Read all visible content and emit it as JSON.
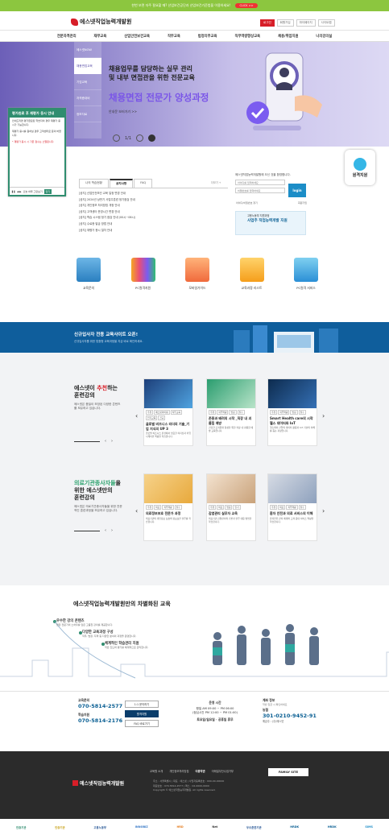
{
  "topbar": {
    "text": "한번 보면 자주 필요할 때? 산업보건공단과 산업보건기준법을 이용하세요!",
    "button": "CLICK >>"
  },
  "header": {
    "logo": "에스넷직업능력개발원",
    "util": [
      "로그인",
      "회원가입",
      "마이페이지",
      "사이트맵"
    ]
  },
  "gnb": [
    "전문자격관리",
    "재무교육",
    "산업안전보건교육",
    "직무교육",
    "법정의무교육",
    "직무역량향상교육",
    "채용/취업지원",
    "나의강의실"
  ],
  "hero": {
    "side": [
      "에스넷NOW",
      "채용면접교육",
      "기업교육",
      "자격증대비",
      "정보자료"
    ],
    "line1": "채용업무를 담당하는 실무 관리",
    "line2": "및 내부 면접관을 위한 전문교육",
    "title": "채용면접 전문가 양성과정",
    "cta": "안내문 보러가기 >>",
    "page": "1/1"
  },
  "popup": {
    "title": "평가완료 후 재평가 응시 안내",
    "body1": "안내드리면 평가완료된 학습자의 경우 재평가 응시가 가능합니다.",
    "body2": "재평가 응시를 원하실 경우 고객센터로 문의 바랍니다.",
    "note": "* 재평가 응시 시 기존 점수는 소멸됩니다.",
    "today": "오늘 하루 그만보기",
    "close": "닫기"
  },
  "recruit": "원격지원",
  "board": {
    "tabs": [
      "나의 학습현황",
      "공지사항",
      "FAQ"
    ],
    "more": "더보기 +",
    "items": [
      "[공지] 산업안전보건 교육 일정 변경 안내",
      "[공지] 2024년 상반기 사업주훈련 정기점검 안내",
      "[공지] 개인정보 처리방침 개정 안내",
      "[공지] 고객센터 운영시간 변경 안내",
      "[공지] 학습 시스템 정기 점검 안내 (00시~06시)",
      "[공지] 수료증 발급 방법 안내",
      "[공지] 재평가 응시 절차 안내"
    ]
  },
  "login": {
    "title": "에스넷직업능력개발원에 오신 것을 환영합니다.",
    "id_ph": "아이디를 입력하세요",
    "pw_ph": "비밀번호를 입력하세요",
    "button": "login",
    "links": [
      "아이디/비밀번호 찾기",
      "회원가입"
    ]
  },
  "banner2": {
    "line1": "고용노동부 지원과정",
    "line2": "사업주 직업능력개발 지원"
  },
  "quick": [
    "교육문의",
    "PC원격지원",
    "모바일가이드",
    "교육과정 리스트",
    "PC원격 서비스"
  ],
  "banner3": {
    "title": "신규입사자 전용 교육사이트 오픈!",
    "sub": "신규입사자를 위한 맞춤형 교육과정을 지금 바로 확인하세요."
  },
  "rec": {
    "t1": "에스넷이 ",
    "t1b": "추천",
    "t1c": "하는",
    "t2": "훈련강의",
    "sub": "에스넷은 품질이 보장된 다양한 콘텐츠를 보유하고 있습니다.",
    "page": "1 / 3",
    "cards": [
      {
        "tags": [
          "추천",
          "에스넷아이템",
          "직무교육",
          "인기교육",
          "신규"
        ],
        "title": "글로벌 비즈니스 리더의 기술_기업 지식의 UP 3",
        "desc": "글로벌 비즈니스 환경에서 필요한 리더십과 커뮤니케이션 역량을 학습합니다."
      },
      {
        "tags": [
          "추천",
          "직무역량",
          "법정",
          "필수"
        ],
        "title": "존중과 배려의 시작 _직장 내 괴롭힘 예방",
        "desc": "건강한 조직문화 형성을 위한 직장 내 괴롭힘 예방 교육입니다."
      },
      {
        "tags": [
          "추천",
          "직무역량",
          "법정",
          "필수"
        ],
        "title": "Smart Health care의 시작 헬스 데이터와 IoT",
        "desc": "헬스케어 산업의 데이터 활용과 IoT 기술의 이해를 돕는 과정입니다."
      }
    ]
  },
  "med": {
    "t1": "의료기관종사자들",
    "t1b": "을",
    "t2": "위한 에스넷만의",
    "t3": "훈련강의",
    "sub": "에스넷은 의료기관종사자들을 위한 전문적인 훈련과정을 보유하고 있습니다.",
    "page": "1 / 3",
    "cards": [
      {
        "tags": [
          "추천",
          "의료",
          "직무역량",
          "필수"
        ],
        "title": "의료정보보호 전문가 과정",
        "desc": "의료기관의 개인정보 보호와 정보보안 실무를 학습합니다."
      },
      {
        "tags": [
          "추천",
          "의료",
          "법정",
          "인기"
        ],
        "title": "감염관리 실무자 교육",
        "desc": "의료기관 감염관리의 기본과 실무 대응 방법을 학습합니다."
      },
      {
        "tags": [
          "추천",
          "의료",
          "직무역량",
          "필수"
        ],
        "title": "환자 안전과 의료 서비스의 이해",
        "desc": "환자안전 관리 체계와 고객 응대 서비스 역량을 학습합니다."
      }
    ]
  },
  "diff": {
    "title": "에스넷직업능력개발원만의 차별화된 교육",
    "items": [
      {
        "t": "우수한 강의 콘텐츠",
        "s": "현장 전문가의 노하우를 담은 고품질 강의를 제공합니다."
      },
      {
        "t": "다양한 교육과정 구성",
        "s": "직무, 법정, 자격 등 다양한 분야의 과정을 운영합니다."
      },
      {
        "t": "체계적인 학습관리 지원",
        "s": "학습 진도와 평가를 체계적으로 관리합니다."
      }
    ]
  },
  "contact": {
    "edu_lbl": "교육문의",
    "edu_tel": "070-5814-2577",
    "fin_lbl": "학습지원",
    "fin_tel": "070-5814-2176",
    "btns": [
      "1:1 문의하기",
      "원격지원",
      "FAQ 바로가기"
    ],
    "hours_lbl": "운영 시간",
    "hours": "평일 AM 09:00 ~ PM 06:00",
    "lunch": "(점심시간 PM 12:00 ~ PM 01:00)",
    "off": "토요일/일요일 · 공휴일 휴무",
    "bank_lbl": "계좌 정보",
    "bank_sub": "학습 입금 시 확인하세요",
    "bank_name": "농협",
    "bank_no": "301-0210-9452-91",
    "bank_holder": "예금주 : (주)에스넷"
  },
  "footer": {
    "links": [
      "교육원 소개",
      "개인정보처리방침",
      "이용약관",
      "이메일무단수집거부"
    ],
    "family": "FAMILY SITE",
    "logo": "에스넷직업능력개발원",
    "addr": "주소 : 서울특별시 | 대표 : 에스넷 | 사업자등록번호 : 000-00-00000",
    "tel": "대표번호 : 070-5814-2577 | 팩스 : 02-0000-0000",
    "copy": "Copyright © 에스넷직업능력개발원. All rights reserved."
  },
  "partners": [
    "인증기관",
    "인증기관",
    "고용노동부",
    "INNOBIZ",
    "HRD",
    "Net",
    "우수훈련기관",
    "HRDK",
    "HRDK",
    "SIMS"
  ]
}
